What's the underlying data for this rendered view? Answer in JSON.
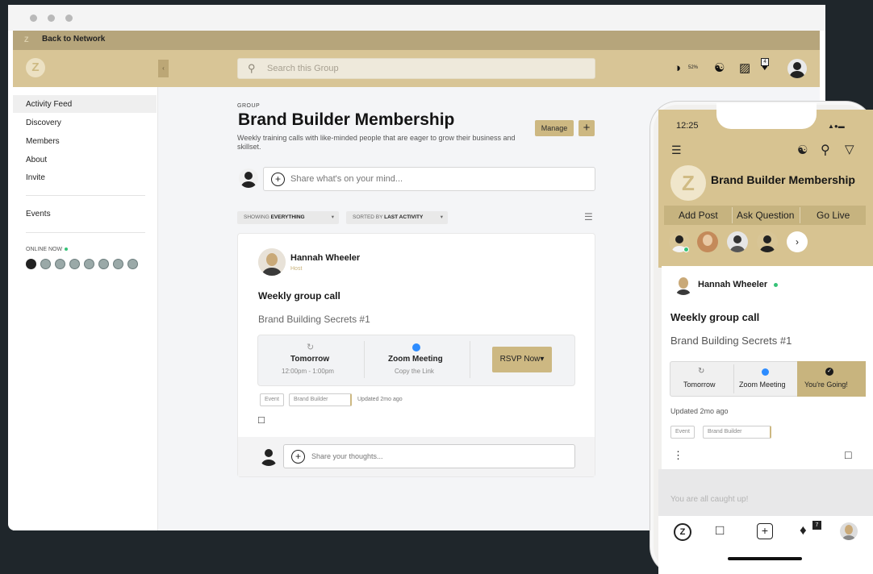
{
  "desktop": {
    "back_label": "Back to Network",
    "search_placeholder": "Search this Group",
    "topbar": {
      "contrast_pct": "52%",
      "notif_count": "4"
    },
    "sidebar": {
      "items": [
        "Activity Feed",
        "Discovery",
        "Members",
        "About",
        "Invite"
      ],
      "events_label": "Events",
      "online_label": "ONLINE NOW"
    },
    "group": {
      "eyebrow": "GROUP",
      "title": "Brand Builder Membership",
      "description": "Weekly training calls with like-minded people that are eager to grow their business and skillset.",
      "manage_label": "Manage",
      "add_label": "+"
    },
    "composer_placeholder": "Share what's on your mind...",
    "filters": {
      "showing_prefix": "SHOWING",
      "showing_value": "EVERYTHING",
      "sorted_prefix": "SORTED BY",
      "sorted_value": "LAST ACTIVITY"
    },
    "post": {
      "author": "Hannah Wheeler",
      "role": "Host",
      "title": "Weekly group call",
      "subtitle": "Brand Building Secrets #1",
      "when_label": "Tomorrow",
      "when_time": "12:00pm - 1:00pm",
      "where_label": "Zoom Meeting",
      "where_sub": "Copy the Link",
      "rsvp_label": "RSVP Now",
      "tags": [
        "Event",
        "Brand Builder"
      ],
      "updated": "Updated 2mo ago",
      "thoughts_placeholder": "Share your thoughts..."
    }
  },
  "phone": {
    "time": "12:25",
    "title": "Brand Builder Membership",
    "tabs": [
      "Add Post",
      "Ask Question",
      "Go Live"
    ],
    "post": {
      "author": "Hannah Wheeler",
      "title": "Weekly group call",
      "subtitle": "Brand Building Secrets #1",
      "when_label": "Tomorrow",
      "where_label": "Zoom Meeting",
      "going_label": "You're Going!",
      "updated": "Updated 2mo ago",
      "tags": [
        "Event",
        "Brand Builder"
      ]
    },
    "caught_up": "You are all caught up!",
    "notif_count": "7"
  },
  "colors": {
    "accent": "#d8c596",
    "accent_dark": "#b6a57b",
    "online": "#36c277",
    "zoom": "#2d8cff"
  }
}
